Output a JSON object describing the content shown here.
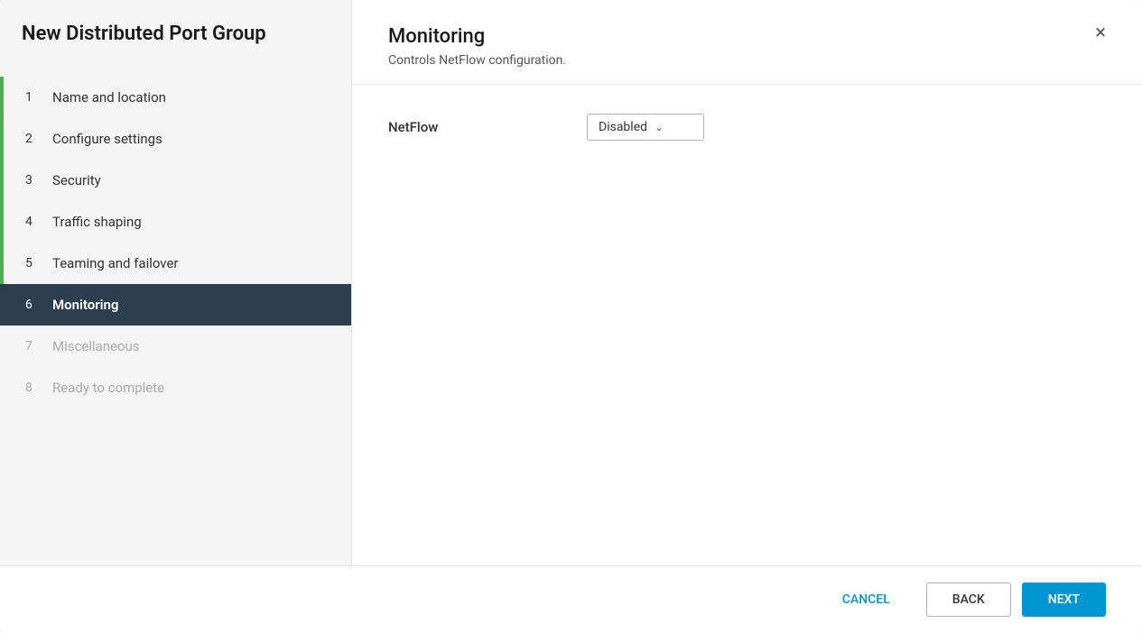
{
  "dialog": {
    "title": "New Distributed Port Group"
  },
  "sidebar": {
    "items": [
      {
        "number": "1",
        "label": "Name and location",
        "state": "completed"
      },
      {
        "number": "2",
        "label": "Configure settings",
        "state": "completed"
      },
      {
        "number": "3",
        "label": "Security",
        "state": "completed"
      },
      {
        "number": "4",
        "label": "Traffic shaping",
        "state": "completed"
      },
      {
        "number": "5",
        "label": "Teaming and failover",
        "state": "completed"
      },
      {
        "number": "6",
        "label": "Monitoring",
        "state": "active"
      },
      {
        "number": "7",
        "label": "Miscellaneous",
        "state": "disabled"
      },
      {
        "number": "8",
        "label": "Ready to complete",
        "state": "disabled"
      }
    ]
  },
  "main": {
    "title": "Monitoring",
    "subtitle": "Controls NetFlow configuration.",
    "close_icon": "×",
    "form": {
      "netflow_label": "NetFlow",
      "netflow_value": "Disabled",
      "chevron": "⌄"
    }
  },
  "footer": {
    "cancel_label": "CANCEL",
    "back_label": "BACK",
    "next_label": "NEXT"
  }
}
